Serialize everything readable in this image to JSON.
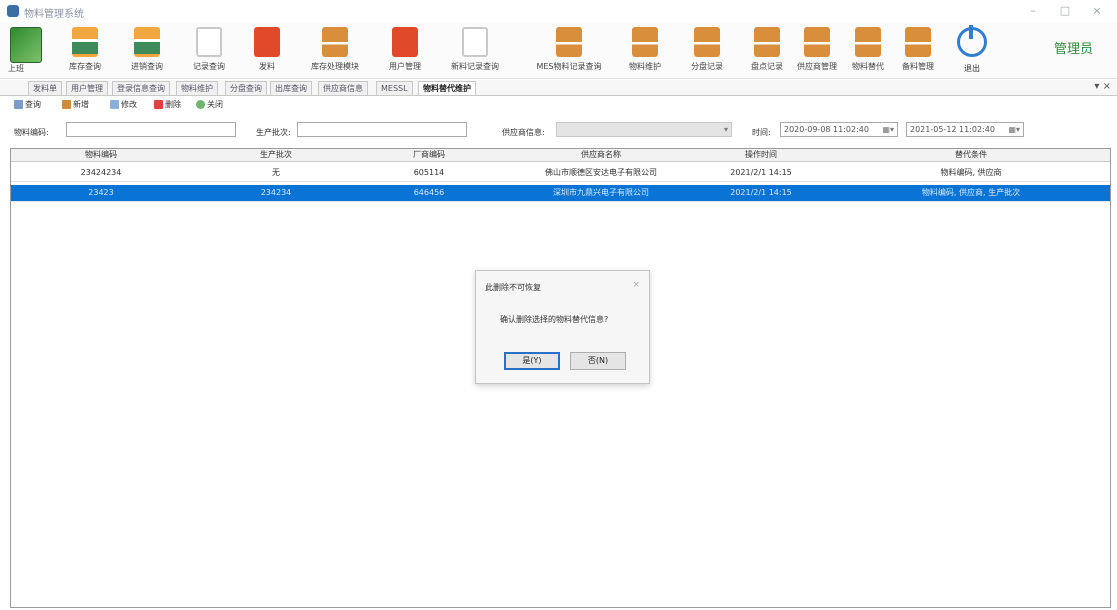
{
  "window": {
    "title": "物料管理系统",
    "min": "–",
    "max": "□",
    "close": "×"
  },
  "toolbar": {
    "items": [
      {
        "label": "上班"
      },
      {
        "label": "库存查询"
      },
      {
        "label": "进销查询"
      },
      {
        "label": "记录查询"
      },
      {
        "label": "发料"
      },
      {
        "label": "库存处理模块"
      },
      {
        "label": "用户管理"
      },
      {
        "label": "新料记录查询"
      },
      {
        "label": "MES物料记录查询"
      },
      {
        "label": "物料维护"
      },
      {
        "label": "分盘记录"
      },
      {
        "label": "盘点记录"
      },
      {
        "label": "供应商管理"
      },
      {
        "label": "物料替代"
      },
      {
        "label": "备料管理"
      },
      {
        "label": "退出"
      }
    ],
    "admin_label": "管理员"
  },
  "tabs": {
    "items": [
      {
        "label": "发料单"
      },
      {
        "label": "用户管理"
      },
      {
        "label": "登录信息查询"
      },
      {
        "label": "物料维护"
      },
      {
        "label": "分盘查询"
      },
      {
        "label": "出库查询"
      },
      {
        "label": "供应商信息"
      },
      {
        "label": "MESSL"
      },
      {
        "label": "物料替代维护"
      }
    ],
    "close_label": "▾ ×"
  },
  "actions": {
    "query": "查询",
    "add": "新增",
    "edit": "修改",
    "delete": "删除",
    "close": "关闭"
  },
  "filter": {
    "material_code_label": "物料编码:",
    "material_code_value": "",
    "mfr_batch_label": "生产批次:",
    "mfr_batch_value": "",
    "supplier_label": "供应商信息:",
    "supplier_value": "",
    "time_label": "时间:",
    "time_from": "2020-09-08 11:02:40",
    "time_to": "2021-05-12 11:02:40"
  },
  "table": {
    "columns": [
      "物料编码",
      "生产批次",
      "厂商编码",
      "供应商名称",
      "操作时间",
      "替代条件"
    ],
    "rows": [
      [
        "23424234",
        "无",
        "605114",
        "佛山市顺德区安达电子有限公司",
        "2021/2/1 14:15",
        "物料编码, 供应商"
      ],
      [
        "23423",
        "234234",
        "646456",
        "深圳市九鼎兴电子有限公司",
        "2021/2/1 14:15",
        "物料编码, 供应商, 生产批次"
      ]
    ],
    "selected_row": 1
  },
  "dialog": {
    "title": "此删除不可恢复",
    "close": "×",
    "message": "确认删除选择的物料替代信息?",
    "yes": "是(Y)",
    "no": "否(N)"
  }
}
